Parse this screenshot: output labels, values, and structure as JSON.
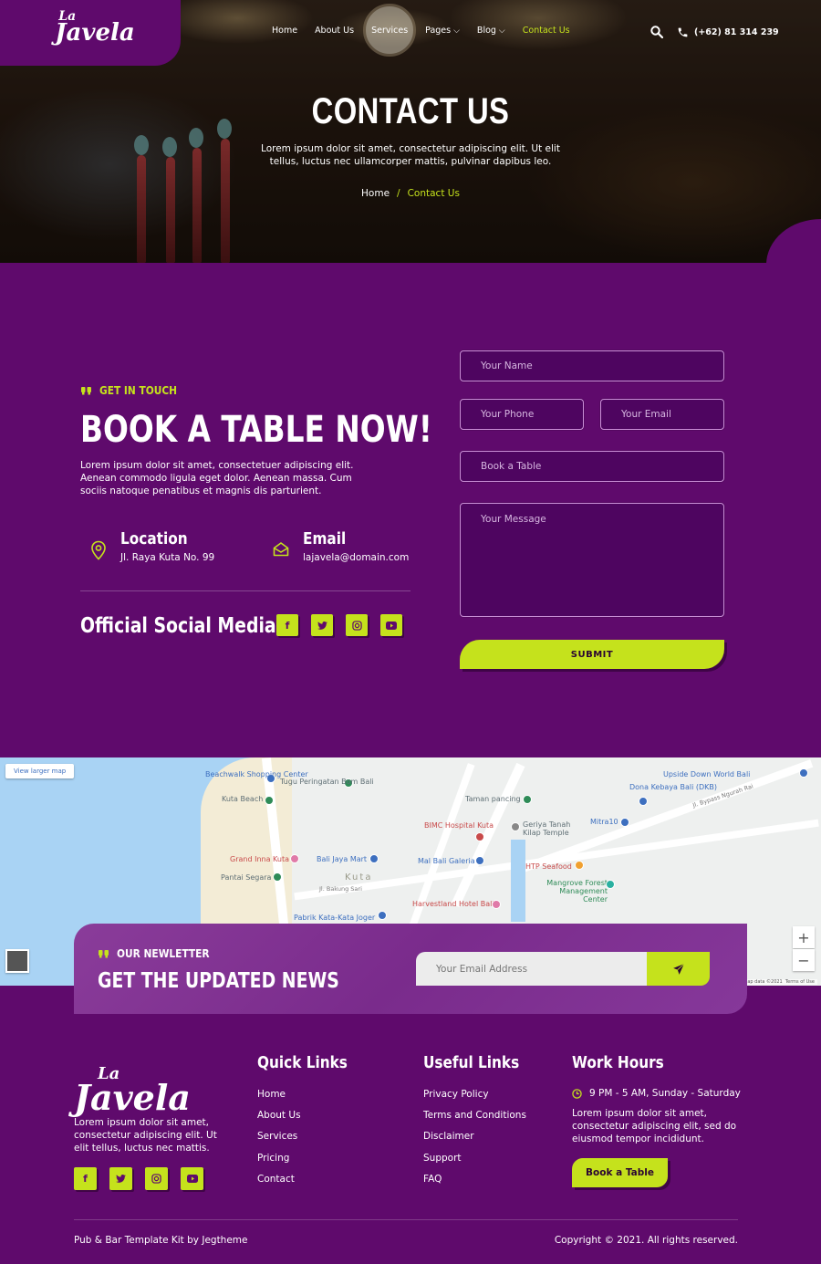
{
  "brand": {
    "logo_top": "La",
    "logo_main": "Javela"
  },
  "nav": {
    "items": [
      {
        "label": "Home",
        "dropdown": false,
        "active": false
      },
      {
        "label": "About Us",
        "dropdown": false,
        "active": false
      },
      {
        "label": "Services",
        "dropdown": false,
        "active": false
      },
      {
        "label": "Pages",
        "dropdown": true,
        "active": false
      },
      {
        "label": "Blog",
        "dropdown": true,
        "active": false
      },
      {
        "label": "Contact Us",
        "dropdown": false,
        "active": true
      }
    ],
    "phone": "(+62) 81 314 239"
  },
  "hero": {
    "title": "CONTACT US",
    "subtitle": "Lorem ipsum dolor sit amet, consectetur adipiscing elit. Ut elit tellus, luctus nec ullamcorper mattis, pulvinar dapibus leo.",
    "breadcrumb": {
      "home": "Home",
      "separator": "/",
      "current": "Contact Us"
    }
  },
  "contact": {
    "tag": "GET IN TOUCH",
    "title": "BOOK A TABLE NOW!",
    "description": "Lorem ipsum dolor sit amet, consectetuer adipiscing elit. Aenean commodo ligula eget dolor. Aenean massa. Cum sociis natoque penatibus et magnis dis parturient.",
    "location_label": "Location",
    "location_value": "Jl. Raya Kuta No. 99",
    "email_label": "Email",
    "email_value": "lajavela@domain.com",
    "social_title": "Official Social Media :"
  },
  "form": {
    "name_placeholder": "Your Name",
    "phone_placeholder": "Your Phone",
    "email_placeholder": "Your Email",
    "table_placeholder": "Book a Table",
    "message_placeholder": "Your Message",
    "submit_label": "SUBMIT"
  },
  "map": {
    "view_larger": "View larger map",
    "labels": {
      "beachwalk": "Beachwalk Shopping Center",
      "tugu": "Tugu Peringatan Bom Bali",
      "kuta_beach": "Kuta Beach",
      "taman": "Taman pancing",
      "upside": "Upside Down World Bali",
      "dona": "Dona Kebaya Bali (DKB)",
      "bimc": "BIMC Hospital Kuta",
      "geriya": "Geriya Tanah Kilap Temple",
      "mitra": "Mitra10",
      "grand_inna": "Grand Inna Kuta",
      "bali_jaya": "Bali Jaya Mart",
      "mal_bali": "Mal Bali Galeria",
      "htp": "HTP Seafood",
      "pantai": "Pantai Segara",
      "kuta": "Kuta",
      "mangrove": "Mangrove Forest Management Center",
      "harvestland": "Harvestland Hotel Bali",
      "pabrik": "Pabrik Kata-Kata Joger",
      "road_bakung": "Jl. Bakung Sari",
      "road_bypass": "Jl. Bypass Ngurah Rai",
      "attribution": "Map data ©2021",
      "terms": "Terms of Use"
    },
    "zoom_in": "+",
    "zoom_out": "−"
  },
  "newsletter": {
    "tag": "OUR NEWLETTER",
    "title": "GET THE UPDATED NEWS",
    "placeholder": "Your Email Address"
  },
  "footer": {
    "description": "Lorem ipsum dolor sit amet, consectetur adipiscing elit. Ut elit tellus, luctus nec mattis.",
    "quick_links_title": "Quick Links",
    "quick_links": [
      "Home",
      "About Us",
      "Services",
      "Pricing",
      "Contact"
    ],
    "useful_links_title": "Useful Links",
    "useful_links": [
      "Privacy Policy",
      "Terms and Conditions",
      "Disclaimer",
      "Support",
      "FAQ"
    ],
    "work_hours_title": "Work Hours",
    "hours": "9 PM - 5 AM, Sunday - Saturday",
    "hours_desc": "Lorem ipsum dolor sit amet, consectetur adipiscing elit, sed do eiusmod tempor incididunt.",
    "book_label": "Book a Table",
    "credit": "Pub & Bar Template Kit by Jegtheme",
    "copyright": "Copyright © 2021. All rights reserved."
  },
  "social_icons": [
    "facebook-icon",
    "twitter-icon",
    "instagram-icon",
    "youtube-icon"
  ],
  "colors": {
    "primary": "#5f0a6c",
    "accent": "#c5e21c",
    "newsletter": "#7a2b8c"
  }
}
